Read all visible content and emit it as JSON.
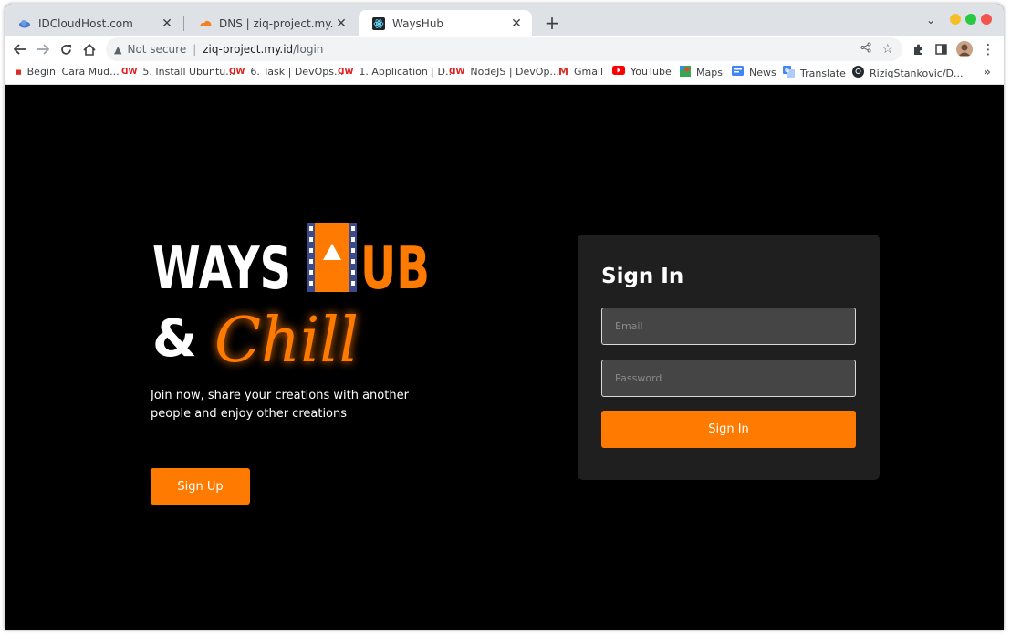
{
  "browser": {
    "tabs": [
      {
        "title": "IDCloudHost.com",
        "icon": "cloud-icon"
      },
      {
        "title": "DNS | ziq-project.my.id | Riziq",
        "icon": "cloudflare-icon"
      },
      {
        "title": "WaysHub",
        "icon": "react-icon"
      }
    ],
    "new_tab_label": "+",
    "address": {
      "security_label": "Not secure",
      "host": "ziq-project.my.id",
      "path": "/login"
    },
    "bookmarks": [
      {
        "label": "Begini Cara Mud...",
        "icon": "news-icon"
      },
      {
        "label": "5. Install Ubuntu...",
        "icon": "dumbways-icon"
      },
      {
        "label": "6. Task | DevOps...",
        "icon": "dumbways-icon"
      },
      {
        "label": "1. Application | D...",
        "icon": "dumbways-icon"
      },
      {
        "label": "NodeJS | DevOp...",
        "icon": "dumbways-icon"
      },
      {
        "label": "Gmail",
        "icon": "gmail-icon"
      },
      {
        "label": "YouTube",
        "icon": "youtube-icon"
      },
      {
        "label": "Maps",
        "icon": "maps-icon"
      },
      {
        "label": "News",
        "icon": "news-icon"
      },
      {
        "label": "Translate",
        "icon": "translate-icon"
      },
      {
        "label": "RiziqStankovic/D...",
        "icon": "github-icon"
      }
    ],
    "bookmarks_more": "»"
  },
  "hero": {
    "logo_word1": "WAYS",
    "logo_word2": "UB",
    "logo_amp": "&",
    "logo_script": "Chill",
    "tagline": "Join now, share your creations with another people and enjoy other creations",
    "signup_label": "Sign Up"
  },
  "signin": {
    "title": "Sign In",
    "email_placeholder": "Email",
    "password_placeholder": "Password",
    "button_label": "Sign In"
  },
  "colors": {
    "accent": "#ff7a00",
    "page_bg": "#000000",
    "card_bg": "#1f1f1f",
    "film_blue": "#3a4a8c"
  }
}
